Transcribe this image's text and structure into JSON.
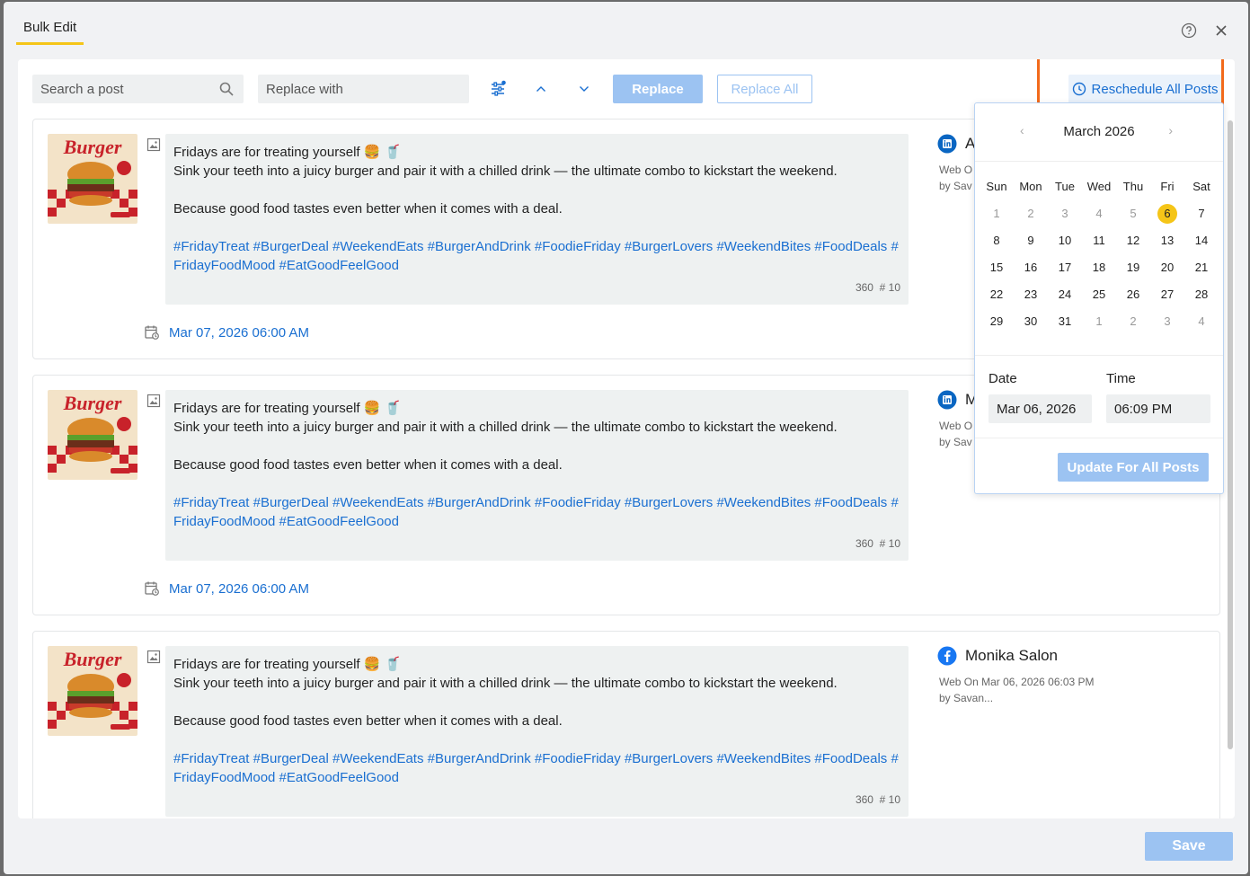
{
  "header": {
    "tab_title": "Bulk Edit"
  },
  "toolbar": {
    "search_placeholder": "Search a post",
    "replace_placeholder": "Replace with",
    "replace_label": "Replace",
    "replace_all_label": "Replace All",
    "reschedule_label": "Reschedule All Posts"
  },
  "posts": [
    {
      "line1": "Fridays are for treating yourself 🍔 🥤",
      "line2": "Sink your teeth into a juicy burger and pair it with a chilled drink — the ultimate combo to kickstart the weekend.",
      "line3": "Because good food tastes even better when it comes with a deal.",
      "hashtags": "#FridayTreat #BurgerDeal #WeekendEats #BurgerAndDrink #FoodieFriday #BurgerLovers #WeekendBites #FoodDeals #FridayFoodMood #EatGoodFeelGood",
      "char_count": "360",
      "hashtag_count": "# 10",
      "schedule": "Mar 07, 2026 06:00 AM",
      "account_name": "A",
      "account_meta_1": "Web O",
      "account_meta_2": "by Sav",
      "network": "linkedin"
    },
    {
      "line1": "Fridays are for treating yourself 🍔 🥤",
      "line2": "Sink your teeth into a juicy burger and pair it with a chilled drink — the ultimate combo to kickstart the weekend.",
      "line3": "Because good food tastes even better when it comes with a deal.",
      "hashtags": "#FridayTreat #BurgerDeal #WeekendEats #BurgerAndDrink #FoodieFriday #BurgerLovers #WeekendBites #FoodDeals #FridayFoodMood #EatGoodFeelGood",
      "char_count": "360",
      "hashtag_count": "# 10",
      "schedule": "Mar 07, 2026 06:00 AM",
      "account_name": "M",
      "account_meta_1": "Web O",
      "account_meta_2": "by Sav",
      "network": "linkedin"
    },
    {
      "line1": "Fridays are for treating yourself 🍔 🥤",
      "line2": "Sink your teeth into a juicy burger and pair it with a chilled drink — the ultimate combo to kickstart the weekend.",
      "line3": "Because good food tastes even better when it comes with a deal.",
      "hashtags": "#FridayTreat #BurgerDeal #WeekendEats #BurgerAndDrink #FoodieFriday #BurgerLovers #WeekendBites #FoodDeals #FridayFoodMood #EatGoodFeelGood",
      "char_count": "360",
      "hashtag_count": "# 10",
      "schedule": "",
      "account_name": "Monika Salon",
      "account_meta_1": "Web On Mar 06, 2026 06:03 PM",
      "account_meta_2": "by Savan...",
      "network": "facebook"
    }
  ],
  "thumbnail": {
    "word": "Burger"
  },
  "datepicker": {
    "month_title": "March 2026",
    "weekdays": [
      "Sun",
      "Mon",
      "Tue",
      "Wed",
      "Thu",
      "Fri",
      "Sat"
    ],
    "weeks": [
      [
        "1",
        "2",
        "3",
        "4",
        "5",
        "6",
        "7"
      ],
      [
        "8",
        "9",
        "10",
        "11",
        "12",
        "13",
        "14"
      ],
      [
        "15",
        "16",
        "17",
        "18",
        "19",
        "20",
        "21"
      ],
      [
        "22",
        "23",
        "24",
        "25",
        "26",
        "27",
        "28"
      ],
      [
        "29",
        "30",
        "31",
        "1",
        "2",
        "3",
        "4"
      ]
    ],
    "muted_first_week_days": 5,
    "muted_last_week_from": 3,
    "selected_day": "6",
    "date_label": "Date",
    "time_label": "Time",
    "date_value": "Mar 06, 2026",
    "time_value": "06:09 PM",
    "update_label": "Update For All Posts"
  },
  "footer": {
    "save_label": "Save"
  },
  "colors": {
    "accent": "#1a6fd1",
    "button_disabled": "#9cc3f2",
    "tab_underline": "#f5c518",
    "highlight": "#f26a1b",
    "linkedin": "#0a66c2",
    "facebook": "#1877f2"
  }
}
